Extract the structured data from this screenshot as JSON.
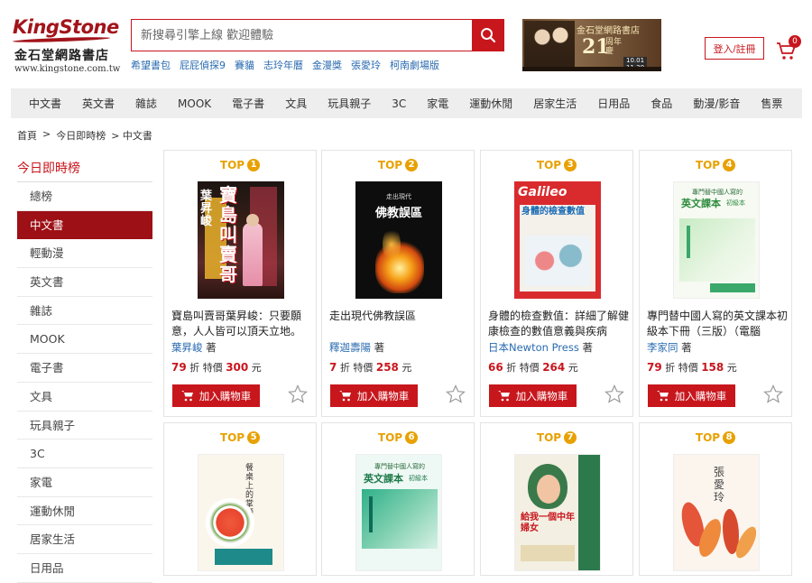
{
  "header": {
    "logo_brand": "KingStone",
    "logo_name": "金石堂網路書店",
    "logo_url": "www.kingstone.com.tw",
    "search_placeholder": "新搜尋引擎上線 歡迎體驗",
    "hotwords": [
      "希望書包",
      "屁屁偵探9",
      "賽貓",
      "志玲年曆",
      "金漫獎",
      "張愛玲",
      "柯南劇場版"
    ],
    "banner": {
      "line1": "金石堂網路書店",
      "number": "21",
      "suffix": "周年慶",
      "dates": "10.01\n11.30"
    },
    "login_label": "登入/註冊",
    "cart_count": "0"
  },
  "nav": [
    "中文書",
    "英文書",
    "雜誌",
    "MOOK",
    "電子書",
    "文具",
    "玩具親子",
    "3C",
    "家電",
    "運動休閒",
    "居家生活",
    "日用品",
    "食品",
    "動漫/影音",
    "售票"
  ],
  "breadcrumb": [
    "首頁",
    ">",
    "今日即時榜",
    "> 中文書"
  ],
  "sidebar": {
    "title": "今日即時榜",
    "items": [
      "總榜",
      "中文書",
      "輕動漫",
      "英文書",
      "雜誌",
      "MOOK",
      "電子書",
      "文具",
      "玩具親子",
      "3C",
      "家電",
      "運動休閒",
      "居家生活",
      "日用品"
    ],
    "active_index": 1
  },
  "products": [
    {
      "rank_label": "TOP",
      "rank": "1",
      "title": "寶島叫賣哥葉昇峻：只要願意，人人皆可以頂天立地。",
      "author": "葉昇峻",
      "author_suffix": "著",
      "discount": "79",
      "discount_unit": "折",
      "price_label": "特價",
      "price": "300",
      "currency": "元",
      "cart_label": "加入購物車"
    },
    {
      "rank_label": "TOP",
      "rank": "2",
      "title": "走出現代佛教誤區",
      "author": "釋迦壽陽",
      "author_suffix": "著",
      "discount": "7",
      "discount_unit": "折",
      "price_label": "特價",
      "price": "258",
      "currency": "元",
      "cart_label": "加入購物車"
    },
    {
      "rank_label": "TOP",
      "rank": "3",
      "title": "身體的檢查數值：詳細了解健康檢查的數值意義與疾病",
      "author": "日本Newton Press",
      "author_suffix": "著",
      "discount": "66",
      "discount_unit": "折",
      "price_label": "特價",
      "price": "264",
      "currency": "元",
      "cart_label": "加入購物車"
    },
    {
      "rank_label": "TOP",
      "rank": "4",
      "title": "專門替中國人寫的英文課本初級本下冊（三版）（電腦",
      "author": "李家同",
      "author_suffix": "著",
      "discount": "79",
      "discount_unit": "折",
      "price_label": "特價",
      "price": "158",
      "currency": "元",
      "cart_label": "加入購物車"
    },
    {
      "rank_label": "TOP",
      "rank": "5"
    },
    {
      "rank_label": "TOP",
      "rank": "6"
    },
    {
      "rank_label": "TOP",
      "rank": "7"
    },
    {
      "rank_label": "TOP",
      "rank": "8"
    }
  ],
  "covers": {
    "c1": {
      "title": "寶島叫賣哥",
      "author": "葉昇峻"
    },
    "c2": {
      "small": "走出現代",
      "title": "佛教誤區"
    },
    "c3": {
      "brand": "Galileo",
      "title": "身體的檢查數值"
    },
    "c4": {
      "small": "專門替中國人寫的",
      "title": "英文課本",
      "sub": "初級本"
    },
    "c5": {
      "title": "餐桌上的掌櫃"
    },
    "c6": {
      "small": "專門替中國人寫的",
      "title": "英文課本",
      "sub": "初級本"
    },
    "c7": {
      "title": "給我一個中年婦女"
    },
    "c8": {
      "title": "張愛玲"
    }
  }
}
